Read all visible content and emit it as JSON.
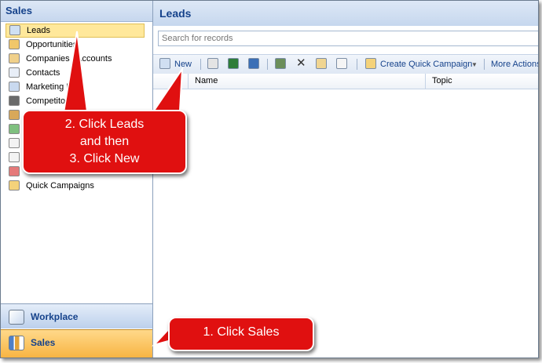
{
  "nav": {
    "title": "Sales",
    "items": [
      {
        "label": "Leads",
        "selected": true,
        "icon": "leads-icon"
      },
      {
        "label": "Opportunities",
        "icon": "opportunities-icon"
      },
      {
        "label": "Companies / Accounts",
        "icon": "companies-icon"
      },
      {
        "label": "Contacts",
        "icon": "contacts-icon"
      },
      {
        "label": "Marketing Lists",
        "icon": "marketing-icon"
      },
      {
        "label": "Competitors",
        "icon": "competitors-icon"
      },
      {
        "label": "",
        "icon": "products-icon"
      },
      {
        "label": "",
        "icon": "quotes-icon"
      },
      {
        "label": "",
        "icon": "orders-icon"
      },
      {
        "label": "",
        "icon": "invoices-icon"
      },
      {
        "label": "",
        "icon": "sales-literature-icon"
      },
      {
        "label": "Quick Campaigns",
        "icon": "quick-campaigns-icon"
      }
    ],
    "workplace": "Workplace",
    "sales": "Sales"
  },
  "main": {
    "title": "Leads",
    "search_placeholder": "Search for records",
    "toolbar": {
      "new": "New",
      "create_quick_campaign": "Create Quick Campaign",
      "more_actions": "More Actions"
    },
    "columns": [
      "Name",
      "Topic"
    ]
  },
  "callouts": {
    "step_top_line1": "2. Click Leads",
    "step_top_line2": "and then",
    "step_top_line3": "3. Click New",
    "step_bottom": "1. Click Sales"
  },
  "colors": {
    "nav_title": "#15428b",
    "selected_item": "#ffe89b",
    "sales_tab": "#f8b443",
    "callout": "#e01010"
  }
}
